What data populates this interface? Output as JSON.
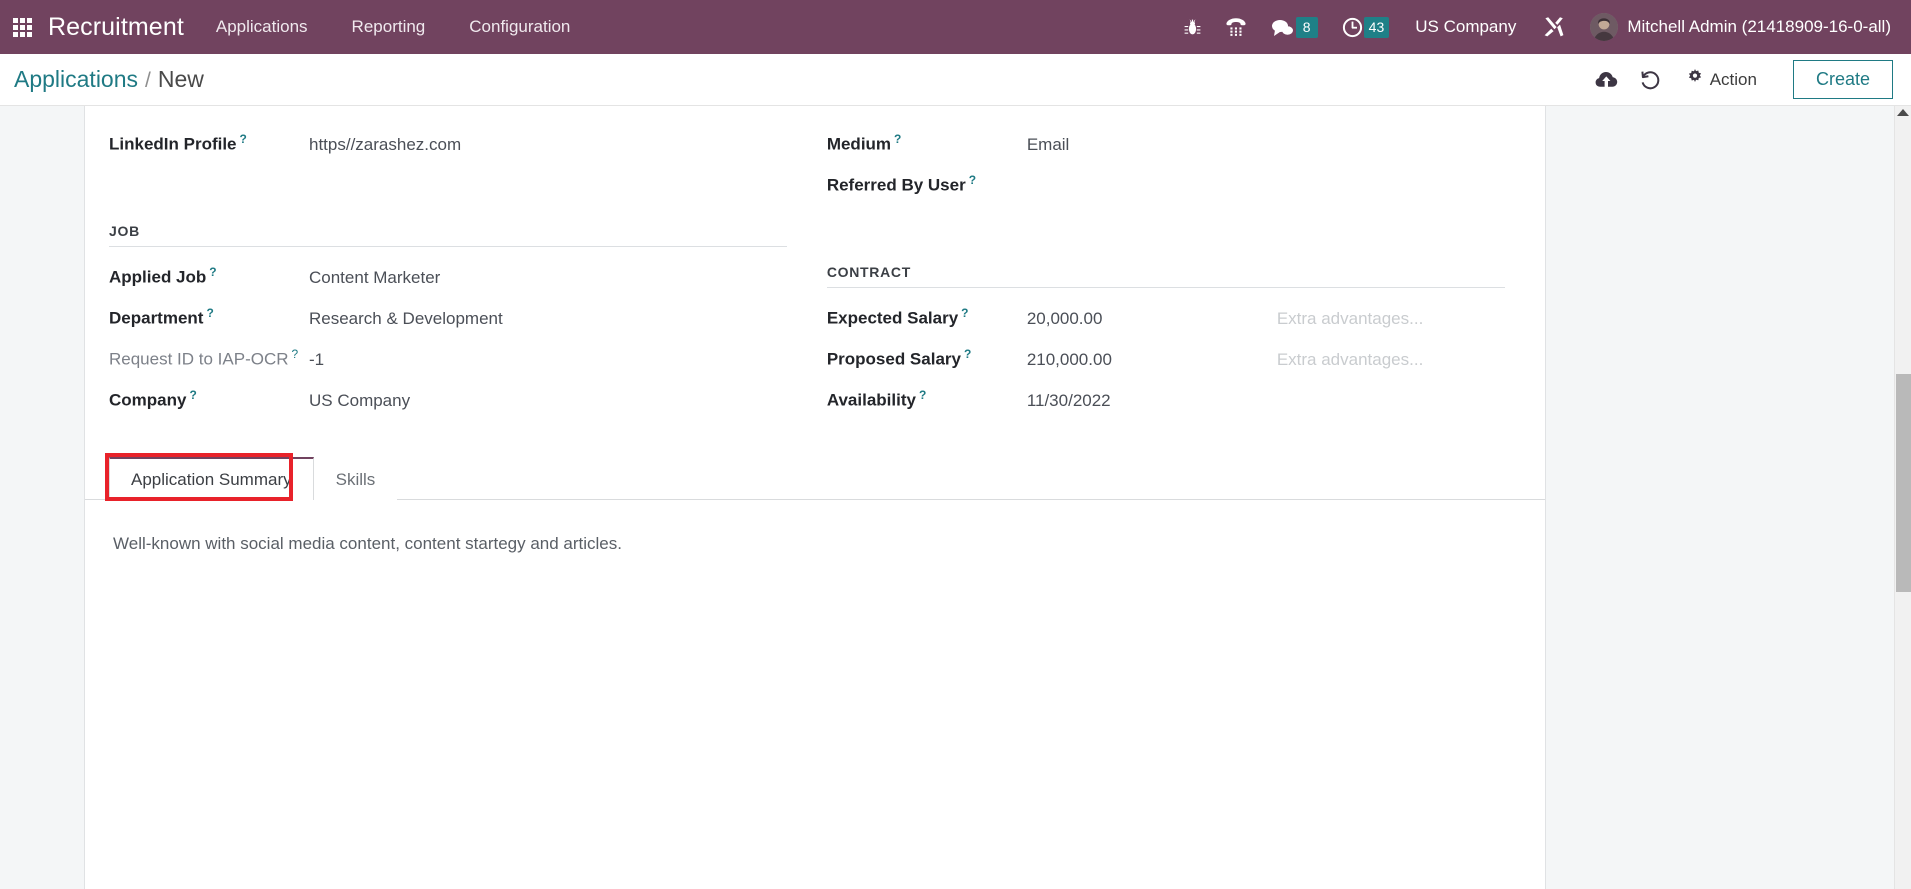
{
  "navbar": {
    "apps_icon": "apps-grid-icon",
    "brand": "Recruitment",
    "menu": [
      {
        "label": "Applications"
      },
      {
        "label": "Reporting"
      },
      {
        "label": "Configuration"
      }
    ],
    "icons": [
      {
        "name": "bug-icon",
        "badge": null
      },
      {
        "name": "phone-icon",
        "badge": null
      },
      {
        "name": "messages-icon",
        "badge": "8"
      },
      {
        "name": "activities-clock-icon",
        "badge": "43"
      }
    ],
    "messages_badge": "8",
    "activities_badge": "43",
    "company": "US Company",
    "tools_icon": "tools-wrench-icon",
    "user_name": "Mitchell Admin (21418909-16-0-all)",
    "colors": {
      "background": "#71435f",
      "badge": "#1f8087"
    }
  },
  "control_panel": {
    "breadcrumb_root": "Applications",
    "breadcrumb_separator": "/",
    "breadcrumb_current": "New",
    "upload_icon": "cloud-upload-icon",
    "discard_icon": "undo-discard-icon",
    "action_label": "Action",
    "action_icon": "gear-icon",
    "create_label": "Create",
    "accent_color": "#1f7a84"
  },
  "form": {
    "left_column": {
      "top_fields": [
        {
          "label": "LinkedIn Profile",
          "help": "?",
          "value": "https//zarashez.com",
          "muted": false
        }
      ],
      "group_title": "JOB",
      "fields": [
        {
          "label": "Applied Job",
          "help": "?",
          "value": "Content Marketer",
          "muted": false
        },
        {
          "label": "Department",
          "help": "?",
          "value": "Research & Development",
          "muted": false
        },
        {
          "label": "Request ID to IAP-OCR",
          "help": "?",
          "value": "-1",
          "muted": true
        },
        {
          "label": "Company",
          "help": "?",
          "value": "US Company",
          "muted": false
        }
      ]
    },
    "right_column": {
      "top_fields": [
        {
          "label": "Medium",
          "help": "?",
          "value": "Email",
          "muted": false
        },
        {
          "label": "Referred By User",
          "help": "?",
          "value": "",
          "muted": false
        }
      ],
      "group_title": "CONTRACT",
      "fields": [
        {
          "label": "Expected Salary",
          "help": "?",
          "value": "20,000.00",
          "extra": "Extra advantages...",
          "muted": false
        },
        {
          "label": "Proposed Salary",
          "help": "?",
          "value": "210,000.00",
          "extra": "Extra advantages...",
          "muted": false
        },
        {
          "label": "Availability",
          "help": "?",
          "value": "11/30/2022",
          "extra": "",
          "muted": false
        }
      ]
    }
  },
  "notebook": {
    "tabs": [
      {
        "label": "Application Summary",
        "active": true,
        "highlighted": true
      },
      {
        "label": "Skills",
        "active": false,
        "highlighted": false
      }
    ],
    "active_pane_text": "Well-known with social media content, content startegy and articles.",
    "highlight_color": "#e8222a"
  },
  "scrollbar": {
    "up_arrow_icon": "scroll-up-arrow-icon",
    "thumb": "vertical-scroll-thumb"
  }
}
